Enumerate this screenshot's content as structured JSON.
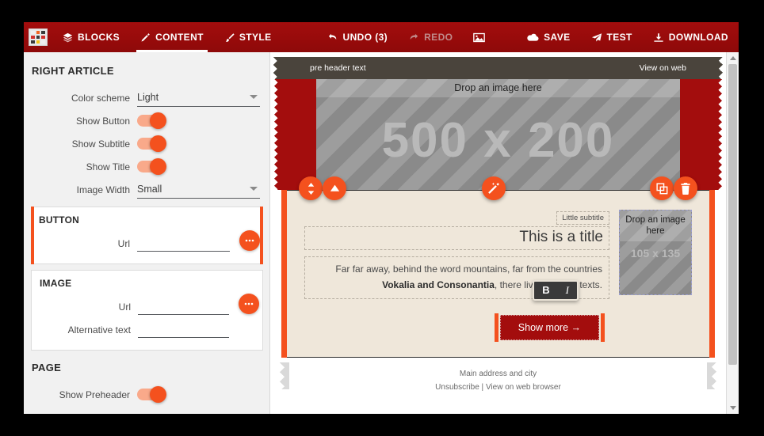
{
  "toolbar": {
    "logo_name": "app-logo",
    "nav": [
      {
        "label": "BLOCKS",
        "icon": "blocks-icon",
        "active": false
      },
      {
        "label": "CONTENT",
        "icon": "pencil-icon",
        "active": true
      },
      {
        "label": "STYLE",
        "icon": "brush-icon",
        "active": false
      }
    ],
    "undo_label": "UNDO (3)",
    "redo_label": "REDO",
    "gallery_icon": "image-icon",
    "actions": [
      {
        "label": "SAVE",
        "icon": "cloud-save-icon"
      },
      {
        "label": "TEST",
        "icon": "paper-plane-icon"
      },
      {
        "label": "DOWNLOAD",
        "icon": "download-icon"
      }
    ],
    "accent_color": "#9e0b0b"
  },
  "sidebar": {
    "section_title": "RIGHT ARTICLE",
    "fields": [
      {
        "label": "Color scheme",
        "type": "select",
        "value": "Light"
      },
      {
        "label": "Show Button",
        "type": "toggle",
        "value": "on"
      },
      {
        "label": "Show Subtitle",
        "type": "toggle",
        "value": "on"
      },
      {
        "label": "Show Title",
        "type": "toggle",
        "value": "on"
      },
      {
        "label": "Image Width",
        "type": "select",
        "value": "Small"
      }
    ],
    "button_panel": {
      "title": "BUTTON",
      "selected": true,
      "url_label": "Url",
      "url_value": "",
      "more_label": "•••"
    },
    "image_panel": {
      "title": "IMAGE",
      "selected": false,
      "url_label": "Url",
      "url_value": "",
      "alt_label": "Alternative text",
      "alt_value": "",
      "more_label": "•••"
    },
    "page_panel": {
      "title": "PAGE",
      "preheader_label": "Show Preheader",
      "preheader_value": "on"
    },
    "accent_color": "#f4511e"
  },
  "canvas": {
    "preheader": {
      "text": "pre header text",
      "view_on_web": "View on web",
      "bg_color": "#4a443c"
    },
    "hero": {
      "drop_label": "Drop an image here",
      "dimensions": "500 x 200",
      "side_color": "#a30d0d"
    },
    "fabs": [
      {
        "name": "move-handle-icon",
        "glyph": "updown"
      },
      {
        "name": "move-up-icon",
        "glyph": "up"
      },
      {
        "name": "magic-wand-icon",
        "glyph": "wand"
      },
      {
        "name": "duplicate-icon",
        "glyph": "copy"
      },
      {
        "name": "delete-icon",
        "glyph": "trash"
      }
    ],
    "article": {
      "subtitle": "Little subtitle",
      "title": "This is a title",
      "paragraph_start": "Far far away, behind the word mountains, far from the countries ",
      "paragraph_bold": "Vokalia and Consonantia",
      "paragraph_end": ", there live the blind texts.",
      "thumb_drop": "Drop an image here",
      "thumb_dims": "105 x 135",
      "bg_color": "#efe7da"
    },
    "rich_toolbar": {
      "bold": "B",
      "italic": "I"
    },
    "cta": {
      "label": "Show more →",
      "bg_color": "#a30d0d"
    },
    "footer": {
      "address": "Main address and city",
      "unsubscribe": "Unsubscribe",
      "separator": "|",
      "view_web": "View on web browser"
    }
  }
}
